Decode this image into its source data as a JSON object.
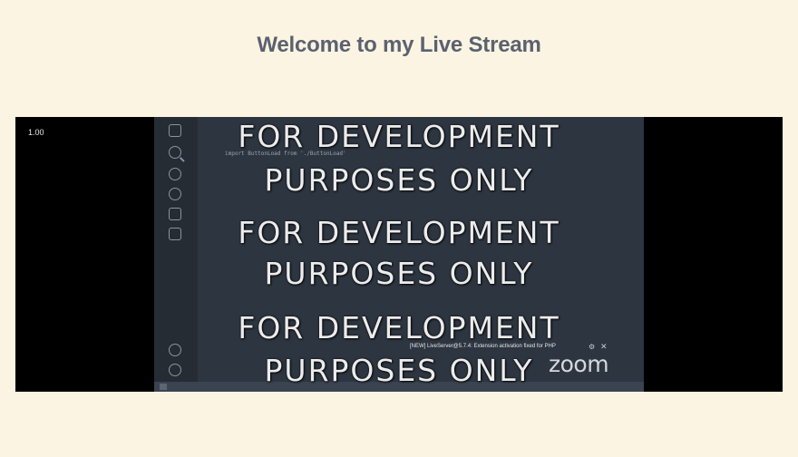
{
  "page": {
    "title": "Welcome to my Live Stream"
  },
  "player": {
    "zoom_readout": "1.00"
  },
  "stream": {
    "watermark_lines": [
      "FOR DEVELOPMENT",
      "PURPOSES ONLY",
      "FOR DEVELOPMENT",
      "PURPOSES ONLY",
      "FOR DEVELOPMENT",
      "PURPOSES ONLY"
    ],
    "code_lines": [
      "import ButtonLoad from './ButtonLoad'"
    ],
    "notification": {
      "text": "[NEW] LiveServer@5.7.4: Extension activation fixed for PHP",
      "gear_icon": "gear-icon",
      "close_icon": "close-icon"
    },
    "zoom_logo": "zoom"
  },
  "colors": {
    "page_background": "#fcf4e2",
    "title_color": "#5b6170",
    "player_background": "#000000",
    "editor_background": "#2d3540"
  }
}
